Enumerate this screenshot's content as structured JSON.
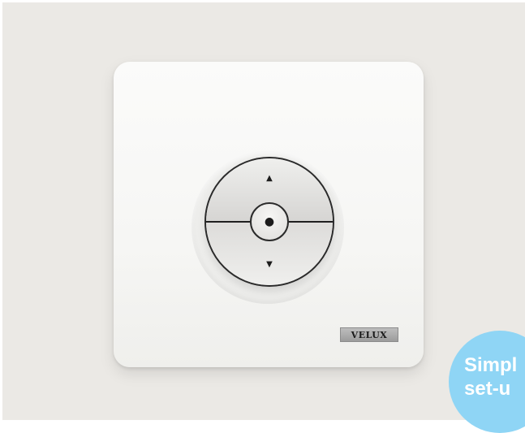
{
  "device": {
    "brand_logo": "VELUX",
    "buttons": {
      "up_icon": "triangle-up-icon",
      "stop_icon": "dot-icon",
      "down_icon": "triangle-down-icon"
    }
  },
  "badge": {
    "line1": "Simpl",
    "line2": "set-u",
    "color": "#8fd5f5"
  },
  "colors": {
    "background": "#ebe9e5",
    "panel": "#f7f7f5",
    "outline": "#2a2a2a"
  }
}
